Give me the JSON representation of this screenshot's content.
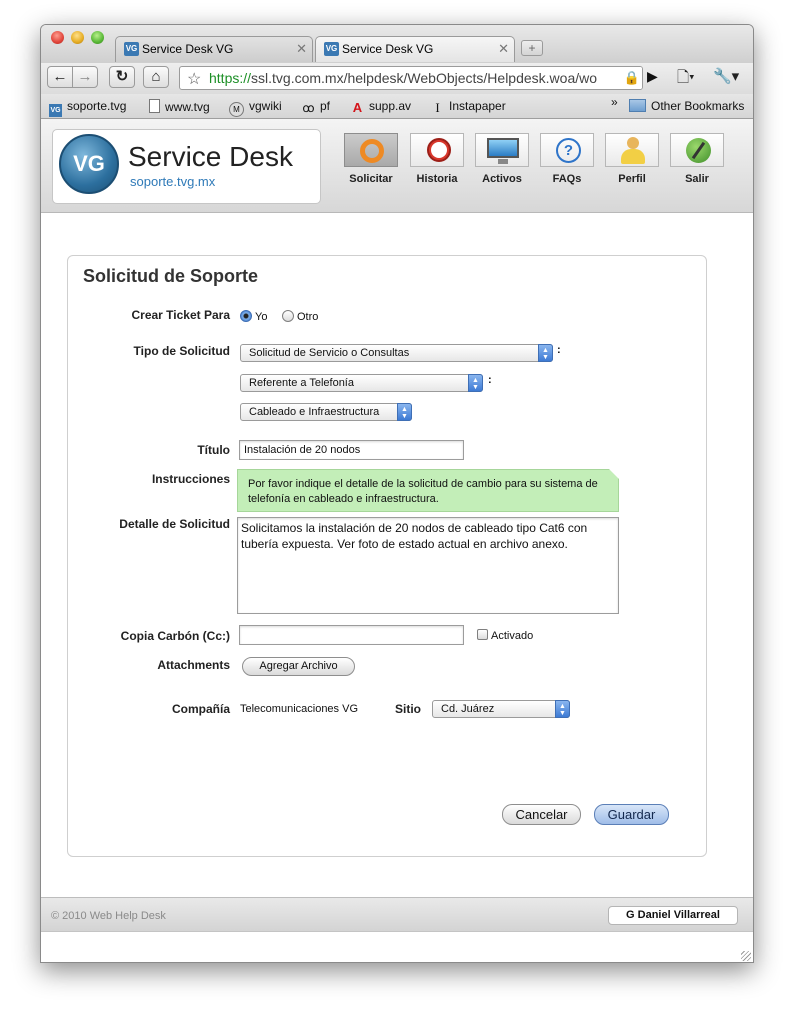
{
  "browser": {
    "tabs": [
      {
        "title": "Service Desk VG",
        "favicon": "VG"
      },
      {
        "title": "Service Desk VG",
        "favicon": "VG"
      }
    ],
    "url": {
      "scheme": "https://",
      "rest": "ssl.tvg.com.mx/helpdesk/WebObjects/Helpdesk.woa/wo"
    },
    "bookmarks": [
      {
        "label": "soporte.tvg",
        "icon": "vg-favicon-icon"
      },
      {
        "label": "www.tvg",
        "icon": "page-icon"
      },
      {
        "label": "vgwiki",
        "icon": "wiki-icon"
      },
      {
        "label": "pf",
        "icon": "pf-icon"
      },
      {
        "label": "supp.av",
        "icon": "adobe-icon"
      },
      {
        "label": "Instapaper",
        "icon": "instapaper-icon"
      }
    ],
    "other_bookmarks": "Other Bookmarks"
  },
  "header": {
    "logo_badge": "VG",
    "title": "Service Desk",
    "subtitle": "soporte.tvg.mx",
    "nav": [
      {
        "label": "Solicitar",
        "icon": "lifebuoy-icon",
        "selected": true
      },
      {
        "label": "Historia",
        "icon": "clock-icon",
        "selected": false
      },
      {
        "label": "Activos",
        "icon": "monitor-icon",
        "selected": false
      },
      {
        "label": "FAQs",
        "icon": "question-icon",
        "selected": false
      },
      {
        "label": "Perfil",
        "icon": "user-icon",
        "selected": false
      },
      {
        "label": "Salir",
        "icon": "exit-icon",
        "selected": false
      }
    ]
  },
  "form": {
    "title": "Solicitud de Soporte",
    "crear_ticket": {
      "label": "Crear Ticket Para",
      "options": [
        "Yo",
        "Otro"
      ],
      "selected": "Yo"
    },
    "tipo": {
      "label": "Tipo de Solicitud",
      "select1": "Solicitud de Servicio o Consultas",
      "select2": "Referente a Telefonía",
      "select3": "Cableado e Infraestructura",
      "separator": ":"
    },
    "titulo": {
      "label": "Título",
      "value": "Instalación de 20 nodos"
    },
    "instrucciones": {
      "label": "Instrucciones",
      "text": "Por favor indique el detalle de la solicitud de cambio para su sistema de telefonía en cableado e infraestructura."
    },
    "detalle": {
      "label": "Detalle de Solicitud",
      "value": "Solicitamos la instalación de 20 nodos de cableado tipo Cat6 con tubería expuesta. Ver foto de estado actual en archivo anexo."
    },
    "cc": {
      "label": "Copia Carbón (Cc:)",
      "value": "",
      "checkbox_label": "Activado",
      "checked": false
    },
    "attachments": {
      "label": "Attachments",
      "button": "Agregar Archivo"
    },
    "compania": {
      "label": "Compañía",
      "value": "Telecomunicaciones VG"
    },
    "sitio": {
      "label": "Sitio",
      "value": "Cd. Juárez"
    },
    "buttons": {
      "cancel": "Cancelar",
      "save": "Guardar"
    }
  },
  "footer": {
    "copyright": "© 2010 Web Help Desk",
    "user": "G Daniel Villarreal"
  }
}
